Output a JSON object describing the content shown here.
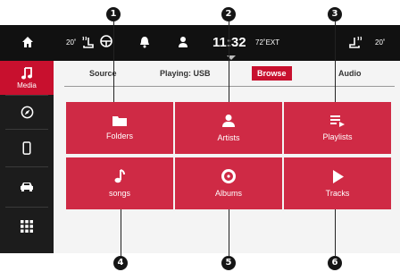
{
  "callouts": [
    "1",
    "2",
    "3",
    "4",
    "5",
    "6"
  ],
  "status_bar": {
    "left_temp": "20˚",
    "time": "11:32",
    "ext_temp": "72˚EXT",
    "right_temp": "20˚"
  },
  "sidebar": {
    "media_label": "Media"
  },
  "tabs": {
    "source": "Source",
    "playing": "Playing: USB",
    "browse": "Browse",
    "audio": "Audio"
  },
  "tiles": [
    {
      "label": "Folders",
      "icon": "folder-icon"
    },
    {
      "label": "Artists",
      "icon": "person-icon"
    },
    {
      "label": "Playlists",
      "icon": "playlist-icon"
    },
    {
      "label": "songs",
      "icon": "music-note-icon"
    },
    {
      "label": "Albums",
      "icon": "disc-icon"
    },
    {
      "label": "Tracks",
      "icon": "play-icon"
    }
  ],
  "colors": {
    "accent": "#c8102e",
    "tile": "#cf2a45",
    "bar": "#111111"
  }
}
